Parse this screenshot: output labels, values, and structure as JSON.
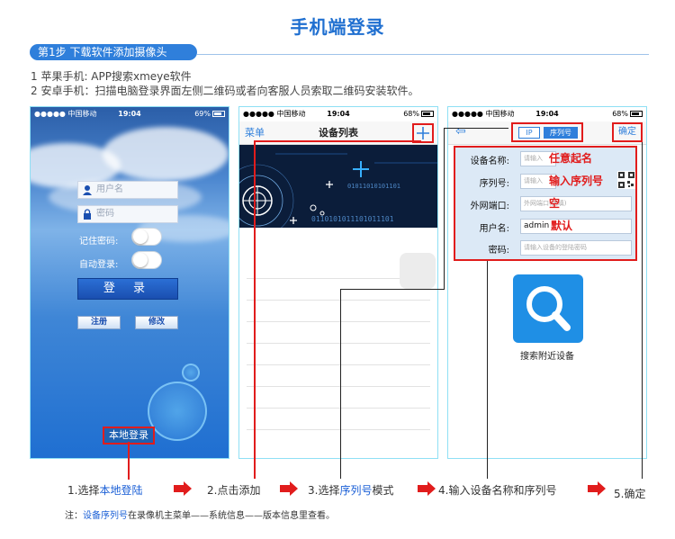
{
  "page_title": "手机端登录",
  "step": "第1步   下载软件添加摄像头",
  "instructions": [
    "1  苹果手机: APP搜索xmeye软件",
    "2  安卓手机：扫描电脑登录界面左侧二维码或者向客服人员索取二维码安装软件。"
  ],
  "phone_status": {
    "carrier": "●●●●● 中国移动",
    "time": "19:04",
    "battery_1": "69%",
    "battery_2": "68%"
  },
  "login_screen": {
    "username_placeholder": "用户名",
    "password_placeholder": "密码",
    "remember_password": "记住密码:",
    "auto_login": "自动登录:",
    "login_button": "登  录",
    "register_button": "注册",
    "modify_button": "修改",
    "local_login": "本地登录"
  },
  "device_list_screen": {
    "menu": "菜单",
    "title": "设备列表",
    "add_symbol": "+",
    "banner_code_1": "01011010101101",
    "banner_code_2": "0110101011101011101"
  },
  "add_device_screen": {
    "back": "⇦",
    "mode_ip": "IP",
    "mode_serial": "序列号",
    "confirm": "确定",
    "fields": [
      {
        "label": "设备名称:",
        "placeholder": "请输入",
        "note": "任意起名"
      },
      {
        "label": "序列号:",
        "placeholder": "请输入",
        "note": "输入序列号"
      },
      {
        "label": "外网端口:",
        "placeholder": "外网端口(选填)",
        "note": "空"
      },
      {
        "label": "用户名:",
        "value": "admin",
        "note": "默认"
      },
      {
        "label": "密码:",
        "placeholder": "请输入设备的登陆密码",
        "note": ""
      }
    ],
    "search_nearby": "搜索附近设备"
  },
  "workflow": {
    "step1_prefix": "1.选择",
    "step1_highlight": "本地登陆",
    "step2": "2.点击添加",
    "step3_prefix": "3.选择",
    "step3_highlight": "序列号",
    "step3_suffix": "模式",
    "step4": "4.输入设备名称和序列号",
    "step5": "5.确定"
  },
  "note": {
    "prefix": "注：",
    "highlight": "设备序列号",
    "suffix": "在录像机主菜单——系统信息——版本信息里查看。"
  },
  "colors": {
    "accent_blue": "#2f7fdb",
    "highlight_red": "#e11c1c",
    "title_blue": "#1f6fd0"
  }
}
